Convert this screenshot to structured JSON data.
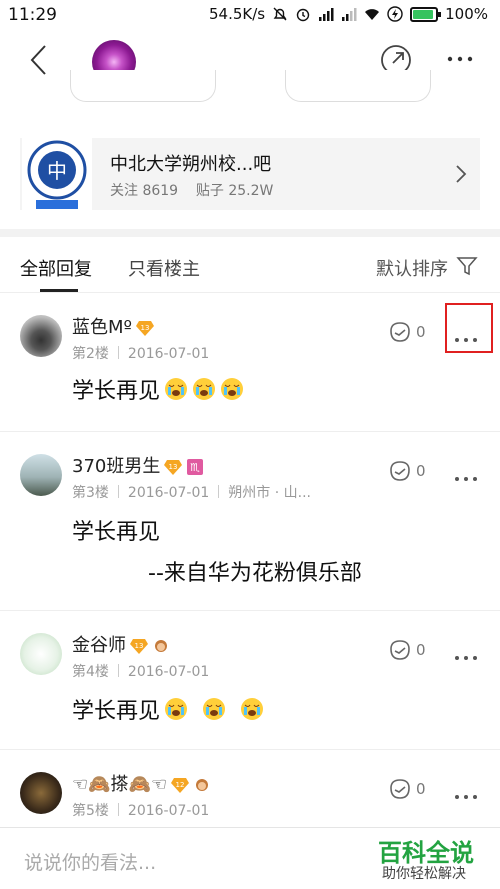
{
  "status_bar": {
    "time": "11:29",
    "net_speed": "54.5K/s",
    "battery": "100%"
  },
  "nav": {
    "back_icon": "chevron-left-icon",
    "share_icon": "share-icon",
    "more_icon": "more-horizontal-icon"
  },
  "forum": {
    "name": "中北大学朔州校...吧",
    "follow": "关注 8619",
    "posts": "贴子 25.2W",
    "logo_text": "NORTH UNIVERSITY OF CHINA"
  },
  "tabs": {
    "all": "全部回复",
    "owner_only": "只看楼主",
    "sort": "默认排序"
  },
  "posts": [
    {
      "username": "蓝色Mº",
      "level": "13",
      "floor": "第2楼",
      "date": "2016-07-01",
      "location": "",
      "content": "学长再见",
      "likes": "0"
    },
    {
      "username": "370班男生",
      "level": "13",
      "floor": "第3楼",
      "date": "2016-07-01",
      "location": "朔州市 · 山...",
      "content": "学长再见",
      "content2": "--来自华为花粉俱乐部",
      "likes": "0"
    },
    {
      "username": "金谷师",
      "level": "13",
      "floor": "第4楼",
      "date": "2016-07-01",
      "location": "",
      "content": "学长再见",
      "likes": "0"
    },
    {
      "username": "☜🙈搽🙈☜",
      "level": "12",
      "floor": "第5楼",
      "date": "2016-07-01",
      "location": "",
      "content": "",
      "likes": "0"
    }
  ],
  "bottom": {
    "placeholder": "说说你的看法...",
    "watermark_title": "百科全说",
    "watermark_sub": "助你轻松解决"
  },
  "colors": {
    "highlight": "#e02020",
    "level_badge": "#f5a623",
    "watermark": "#23a341"
  }
}
